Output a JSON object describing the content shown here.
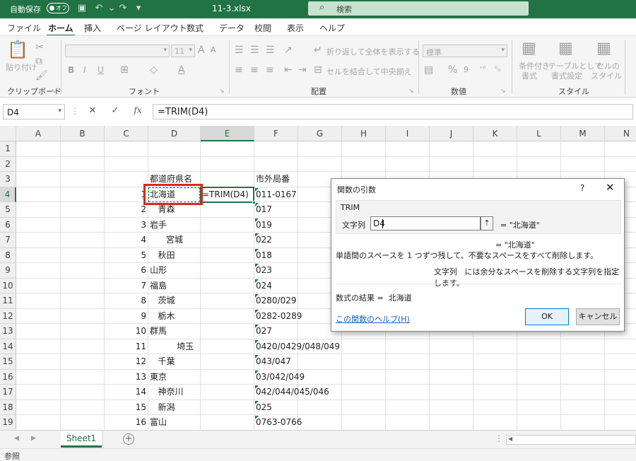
{
  "titlebar": {
    "autosave_label": "自動保存",
    "autosave_state": "オフ",
    "filename": "11-3.xlsx",
    "search_placeholder": "検索"
  },
  "menu": {
    "tabs": [
      "ファイル",
      "ホーム",
      "挿入",
      "ページ レイアウト",
      "数式",
      "データ",
      "校閲",
      "表示",
      "ヘルプ"
    ],
    "active": "ホーム"
  },
  "ribbon": {
    "clipboard": {
      "paste": "貼り付け",
      "label": "クリップボード"
    },
    "font": {
      "size": "11",
      "bold": "B",
      "italic": "I",
      "underline": "U",
      "label": "フォント"
    },
    "alignment": {
      "wrap": "折り返して全体を表示する",
      "merge": "セルを結合して中央揃え",
      "label": "配置"
    },
    "number": {
      "format": "標準",
      "label": "数値"
    },
    "styles": {
      "conditional_1": "条件付き",
      "conditional_2": "書式",
      "table_1": "テーブルとして",
      "table_2": "書式設定",
      "cell_1": "セルの",
      "cell_2": "スタイル",
      "label": "スタイル"
    }
  },
  "formula_bar": {
    "name_box": "D4",
    "formula": "=TRIM(D4)"
  },
  "grid": {
    "columns": [
      "A",
      "B",
      "C",
      "D",
      "E",
      "F",
      "G",
      "H",
      "I",
      "J",
      "K",
      "L",
      "M",
      "N"
    ],
    "selected_column": "E",
    "selected_row": "4",
    "header_row": {
      "d": "都道府県名",
      "f": "市外局番"
    },
    "rows": [
      {
        "n": "1"
      },
      {
        "n": "2"
      },
      {
        "n": "3"
      },
      {
        "n": "4",
        "c": "1",
        "d": "北海道",
        "e": "=TRIM(D4)",
        "f": "011-0167"
      },
      {
        "n": "5",
        "c": "2",
        "d": "   青森",
        "f": "017"
      },
      {
        "n": "6",
        "c": "3",
        "d": "岩手",
        "f": "019"
      },
      {
        "n": "7",
        "c": "4",
        "d": "      宮城",
        "f": "022"
      },
      {
        "n": "8",
        "c": "5",
        "d": "   秋田",
        "f": "018"
      },
      {
        "n": "9",
        "c": "6",
        "d": "山形",
        "f": "023"
      },
      {
        "n": "10",
        "c": "7",
        "d": "福島",
        "f": "024"
      },
      {
        "n": "11",
        "c": "8",
        "d": "   茨城",
        "f": "0280/029"
      },
      {
        "n": "12",
        "c": "9",
        "d": "   栃木",
        "f": "0282-0289"
      },
      {
        "n": "13",
        "c": "10",
        "d": "群馬",
        "f": "027"
      },
      {
        "n": "14",
        "c": "11",
        "d": "          埼玉",
        "f": "0420/0429/048/049"
      },
      {
        "n": "15",
        "c": "12",
        "d": "   千葉",
        "f": "043/047"
      },
      {
        "n": "16",
        "c": "13",
        "d": "東京",
        "f": "03/042/049"
      },
      {
        "n": "17",
        "c": "14",
        "d": "   神奈川",
        "f": "042/044/045/046"
      },
      {
        "n": "18",
        "c": "15",
        "d": "   新潟",
        "f": "025"
      },
      {
        "n": "19",
        "c": "16",
        "d": "富山",
        "f": "0763-0766"
      }
    ]
  },
  "dialog": {
    "title": "関数の引数",
    "help_char": "?",
    "close_char": "✕",
    "function_name": "TRIM",
    "arg_label": "文字列",
    "arg_value": "D4",
    "collapse_char": "⇡",
    "arg_result": "= \"北海道\"",
    "overall_result": "= \"北海道\"",
    "description": "単語間のスペースを 1 つずつ残して、不要なスペースをすべて削除します。",
    "arg_description_name": "文字列",
    "arg_description": "には余分なスペースを削除する文字列を指定します。",
    "formula_result_label": "数式の結果 =",
    "formula_result_value": "北海道",
    "help_link": "この関数のヘルプ(H)",
    "ok_label": "OK",
    "cancel_label": "キャンセル"
  },
  "sheet_tabs": {
    "active": "Sheet1",
    "add": "+"
  },
  "status": {
    "mode": "参照"
  },
  "colors": {
    "excel_green": "#217346",
    "highlight_red": "#e0251b",
    "link_blue": "#1a5fb4"
  }
}
